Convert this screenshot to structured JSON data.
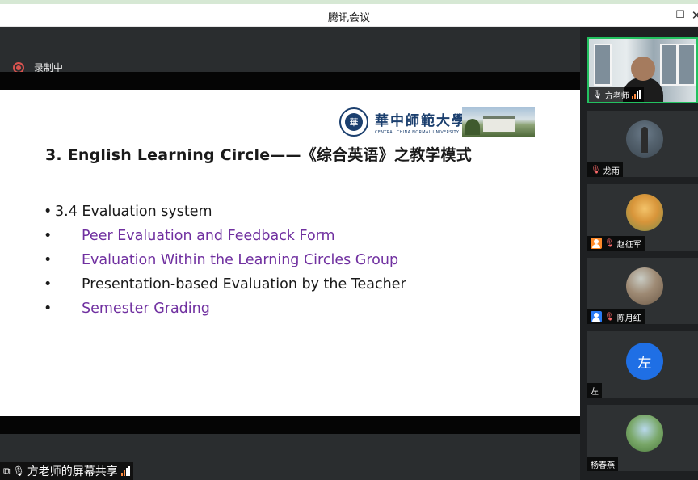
{
  "window": {
    "title": "腾讯会议",
    "minimize_glyph": "—",
    "maximize_glyph": "☐",
    "close_glyph": "✕"
  },
  "recording": {
    "label": "录制中",
    "icon": "record-icon",
    "color": "#d9534f"
  },
  "slide": {
    "title": "3. English Learning Circle——《综合英语》之教学模式",
    "logo": {
      "cn_name": "華中師範大學",
      "en_name": "CENTRAL CHINA NORMAL UNIVERSITY",
      "seal_glyph": "華"
    },
    "bullets": [
      {
        "marker": "•",
        "text": "3.4 Evaluation system",
        "level": 0,
        "color": "#1a1a1a"
      },
      {
        "marker": "•",
        "text": "Peer Evaluation and Feedback Form",
        "level": 1,
        "color": "#7030a0"
      },
      {
        "marker": "•",
        "text": "Evaluation Within the Learning Circles Group",
        "level": 1,
        "color": "#7030a0"
      },
      {
        "marker": "•",
        "text": "Presentation-based Evaluation by the Teacher",
        "level": 1,
        "color": "#1a1a1a"
      },
      {
        "marker": "•",
        "text": "Semester Grading",
        "level": 1,
        "color": "#7030a0"
      }
    ]
  },
  "screen_share": {
    "label": "方老师的屏幕共享",
    "icons": [
      "screen-share-icon",
      "mic-icon",
      "signal-icon"
    ]
  },
  "participants": [
    {
      "name": "方老师",
      "mic": "on",
      "video": true,
      "active": true
    },
    {
      "name": "龙雨",
      "mic": "muted",
      "video": false
    },
    {
      "name": "赵征军",
      "mic": "muted",
      "video": false,
      "role_badge": "orange"
    },
    {
      "name": "陈月红",
      "mic": "muted",
      "video": false,
      "role_badge": "blue"
    },
    {
      "name": "左",
      "mic": "none",
      "video": false,
      "avatar_letter": "左"
    },
    {
      "name": "杨春燕",
      "mic": "none",
      "video": false
    }
  ],
  "colors": {
    "accent_green": "#23c160",
    "slide_purple": "#7030a0",
    "avatar_blue": "#1f6fe5"
  }
}
